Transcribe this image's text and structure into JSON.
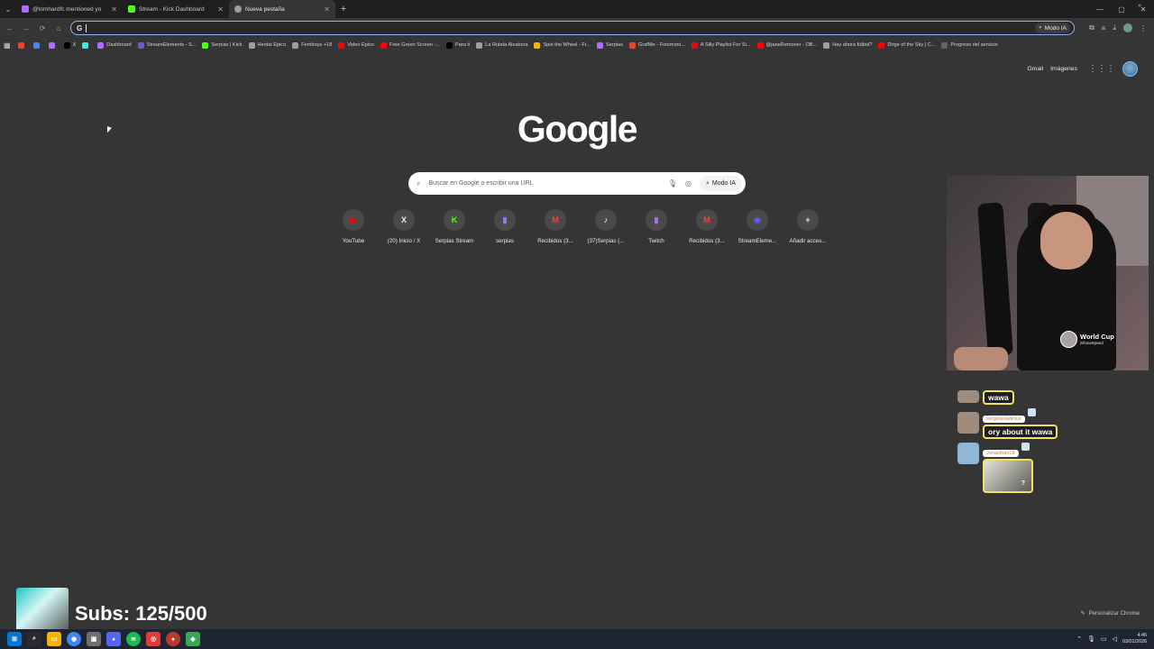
{
  "tabs": [
    {
      "label": "@tomhardfc mentioned yo",
      "favicon_color": "#a970ff",
      "active": false
    },
    {
      "label": "Stream - Kick Dashboard",
      "favicon_color": "#53fc18",
      "active": false
    },
    {
      "label": "Nueva pestaña",
      "favicon_color": "#9aa0a6",
      "active": true
    }
  ],
  "omnibox": {
    "value": "",
    "modo_ia_label": "Modo IA"
  },
  "bookmarks": [
    {
      "label": "",
      "color": "#ea4335"
    },
    {
      "label": "",
      "color": "#4285f4"
    },
    {
      "label": "",
      "color": "#a970ff"
    },
    {
      "label": "X",
      "color": "#000000"
    },
    {
      "label": "",
      "color": "#25f4ee"
    },
    {
      "label": "Dashboard",
      "color": "#a970ff"
    },
    {
      "label": "StreamElements - S...",
      "color": "#6a5acd"
    },
    {
      "label": "Serpias | Kick",
      "color": "#53fc18"
    },
    {
      "label": "Hentai Epico",
      "color": "#9aa0a6"
    },
    {
      "label": "Femboys +18",
      "color": "#9aa0a6"
    },
    {
      "label": "Video Epico",
      "color": "#ff0000"
    },
    {
      "label": "Free Green Screen -...",
      "color": "#ff0000"
    },
    {
      "label": "Para ti",
      "color": "#000000"
    },
    {
      "label": "La Ruleta Aleatoria",
      "color": "#9aa0a6"
    },
    {
      "label": "Spin the Wheel - Fr...",
      "color": "#f4b400"
    },
    {
      "label": "Serpias",
      "color": "#a970ff"
    },
    {
      "label": "GrafMe - Fotomont...",
      "color": "#ea4335"
    },
    {
      "label": "A Silly Playlist For Si...",
      "color": "#ff0000"
    },
    {
      "label": "@janeRemover - OB...",
      "color": "#ff0000"
    },
    {
      "label": "Hay ahora fútbol?",
      "color": "#9aa0a6"
    },
    {
      "label": "Dirge of the Sky | C...",
      "color": "#ff0000"
    },
    {
      "label": "Progreso del servicio",
      "color": "#5f6368"
    }
  ],
  "google": {
    "gmail": "Gmail",
    "images": "Imágenes",
    "logo": "Google",
    "search_placeholder": "Buscar en Google o escribir una URL",
    "modo_ia": "Modo IA",
    "customize": "Personalizar Chrome"
  },
  "shortcuts": [
    {
      "label": "YouTube",
      "glyph": "▶",
      "color": "#ff0000"
    },
    {
      "label": "(20) Inicio / X",
      "glyph": "X",
      "color": "#e8eaed"
    },
    {
      "label": "Serpias Stream",
      "glyph": "K",
      "color": "#53fc18"
    },
    {
      "label": "serpias",
      "glyph": "▮",
      "color": "#a970ff"
    },
    {
      "label": "Recibidos (3...",
      "glyph": "M",
      "color": "#ea4335"
    },
    {
      "label": "(37)Serpias (...",
      "glyph": "♪",
      "color": "#ffffff"
    },
    {
      "label": "Twitch",
      "glyph": "▮",
      "color": "#a970ff"
    },
    {
      "label": "Recibidos (3...",
      "glyph": "M",
      "color": "#ea4335"
    },
    {
      "label": "StreamEleme...",
      "glyph": "◉",
      "color": "#5b5bf5"
    },
    {
      "label": "Añadir acces...",
      "glyph": "+",
      "color": "#e8eaed"
    }
  ],
  "webcam": {
    "badge_title": "World Cup",
    "badge_sub": "iShowSpeed"
  },
  "chat": [
    {
      "user": "",
      "text": "wawa"
    },
    {
      "user": "sergioaviadroux",
      "text": "ory about it wawa"
    },
    {
      "user": "Jonasthan18",
      "text": "?"
    }
  ],
  "subs": {
    "text": "Subs: 125/500"
  },
  "taskbar": {
    "time": "4:46",
    "date": "03/01/2026"
  }
}
